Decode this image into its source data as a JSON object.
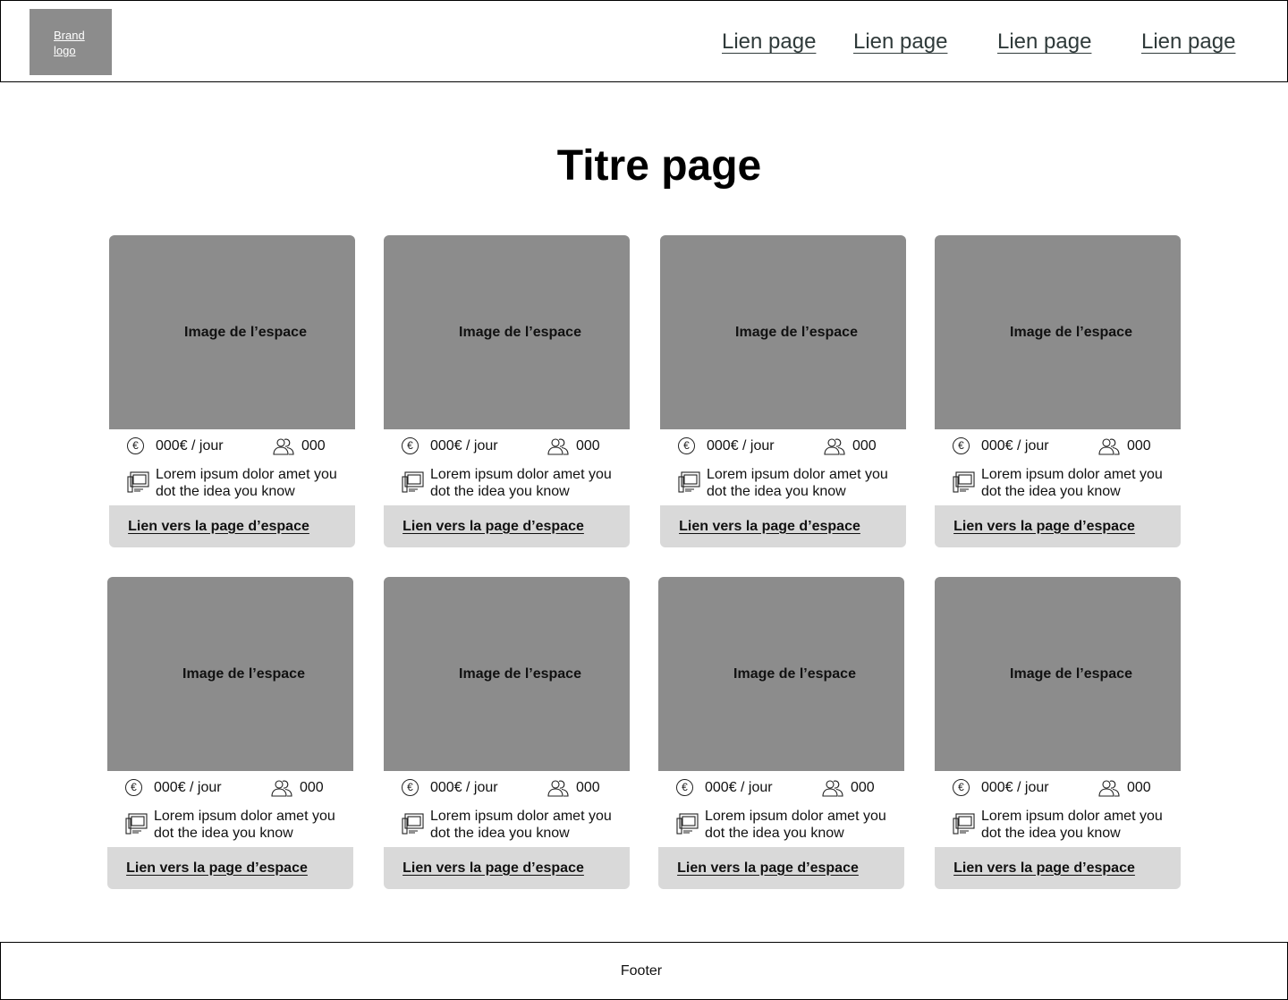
{
  "header": {
    "brand": [
      "Brand",
      "logo"
    ],
    "nav": [
      "Lien page",
      "Lien page",
      "Lien page",
      "Lien page"
    ]
  },
  "main": {
    "title": "Titre page",
    "cards": [
      {
        "image_label": "Image de l’espace",
        "price": "000€ / jour",
        "capacity": "000",
        "description": "Lorem ipsum dolor amet you dot the idea you know",
        "link": "Lien vers la page d’espace"
      },
      {
        "image_label": "Image de l’espace",
        "price": "000€ / jour",
        "capacity": "000",
        "description": "Lorem ipsum dolor amet you dot the idea you know",
        "link": "Lien vers la page d’espace"
      },
      {
        "image_label": "Image de l’espace",
        "price": "000€ / jour",
        "capacity": "000",
        "description": "Lorem ipsum dolor amet you dot the idea you know",
        "link": "Lien vers la page d’espace"
      },
      {
        "image_label": "Image de l’espace",
        "price": "000€ / jour",
        "capacity": "000",
        "description": "Lorem ipsum dolor amet you dot the idea you know",
        "link": "Lien vers la page d’espace"
      },
      {
        "image_label": "Image de l’espace",
        "price": "000€ / jour",
        "capacity": "000",
        "description": "Lorem ipsum dolor amet you dot the idea you know",
        "link": "Lien vers la page d’espace"
      },
      {
        "image_label": "Image de l’espace",
        "price": "000€ / jour",
        "capacity": "000",
        "description": "Lorem ipsum dolor amet you dot the idea you know",
        "link": "Lien vers la page d’espace"
      },
      {
        "image_label": "Image de l’espace",
        "price": "000€ / jour",
        "capacity": "000",
        "description": "Lorem ipsum dolor amet you dot the idea you know",
        "link": "Lien vers la page d’espace"
      },
      {
        "image_label": "Image de l’espace",
        "price": "000€ / jour",
        "capacity": "000",
        "description": "Lorem ipsum dolor amet you dot the idea you know",
        "link": "Lien vers la page d’espace"
      }
    ]
  },
  "icons": {
    "price": "euro-icon",
    "capacity": "people-icon",
    "description": "screen-icon"
  },
  "footer": {
    "label": "Footer"
  }
}
